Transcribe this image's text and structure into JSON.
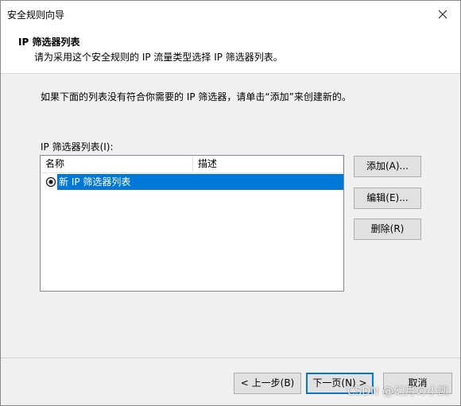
{
  "window": {
    "title": "安全规则向导"
  },
  "header": {
    "title": "IP 筛选器列表",
    "subtitle": "请为采用这个安全规则的 IP 流量类型选择 IP 筛选器列表。"
  },
  "main": {
    "instruction": "如果下面的列表没有符合你需要的 IP 筛选器，请单击“添加”来创建新的。",
    "list_label": "IP 筛选器列表(I):",
    "columns": [
      "名称",
      "描述"
    ],
    "rows": [
      {
        "name": "新 IP 筛选器列表",
        "description": "",
        "selected": true
      }
    ]
  },
  "side_buttons": {
    "add": "添加(A)...",
    "edit": "编辑(E)...",
    "remove": "删除(R)"
  },
  "footer": {
    "back": "< 上一步(B)",
    "next": "下一页(N) >",
    "cancel": "取消"
  },
  "watermark": "CSDN @幻月の小凯",
  "colors": {
    "selection": "#0078d7",
    "button_face": "#e1e1e1",
    "dialog_bg": "#f0f0f0"
  },
  "icons": {
    "close": "close-icon",
    "radio": "radio-selected-icon"
  }
}
